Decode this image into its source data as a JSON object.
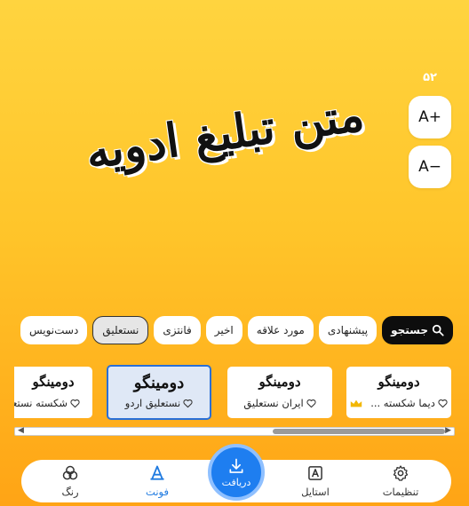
{
  "size": {
    "value": "۵۲",
    "increase_label": "A+",
    "decrease_label": "A−"
  },
  "preview": {
    "text": "متن تبلیغ ادویه"
  },
  "categories": [
    {
      "label": "جستجو",
      "type": "search",
      "icon": "search-icon"
    },
    {
      "label": "پیشنهادی"
    },
    {
      "label": "مورد علاقه"
    },
    {
      "label": "اخیر"
    },
    {
      "label": "فانتزی"
    },
    {
      "label": "نستعلیق",
      "active": true
    },
    {
      "label": "دست‌نویس"
    }
  ],
  "fonts": [
    {
      "sample": "دومینگو",
      "label": "دیما شکسته ...",
      "premium": true
    },
    {
      "sample": "دومینگو",
      "label": "ایران نستعلیق"
    },
    {
      "sample": "دومینگو",
      "label": "نستعلیق اردو",
      "selected": true
    },
    {
      "sample": "دومینگو",
      "label": "شکسته نستعلیق"
    }
  ],
  "nav": {
    "settings": "تنظیمات",
    "style": "استایل",
    "download": "دریافت",
    "font": "فونت",
    "color": "رنگ"
  },
  "colors": {
    "accent": "#1e7ef0",
    "background_top": "#ffd43f",
    "background_bottom": "#ffa415"
  }
}
